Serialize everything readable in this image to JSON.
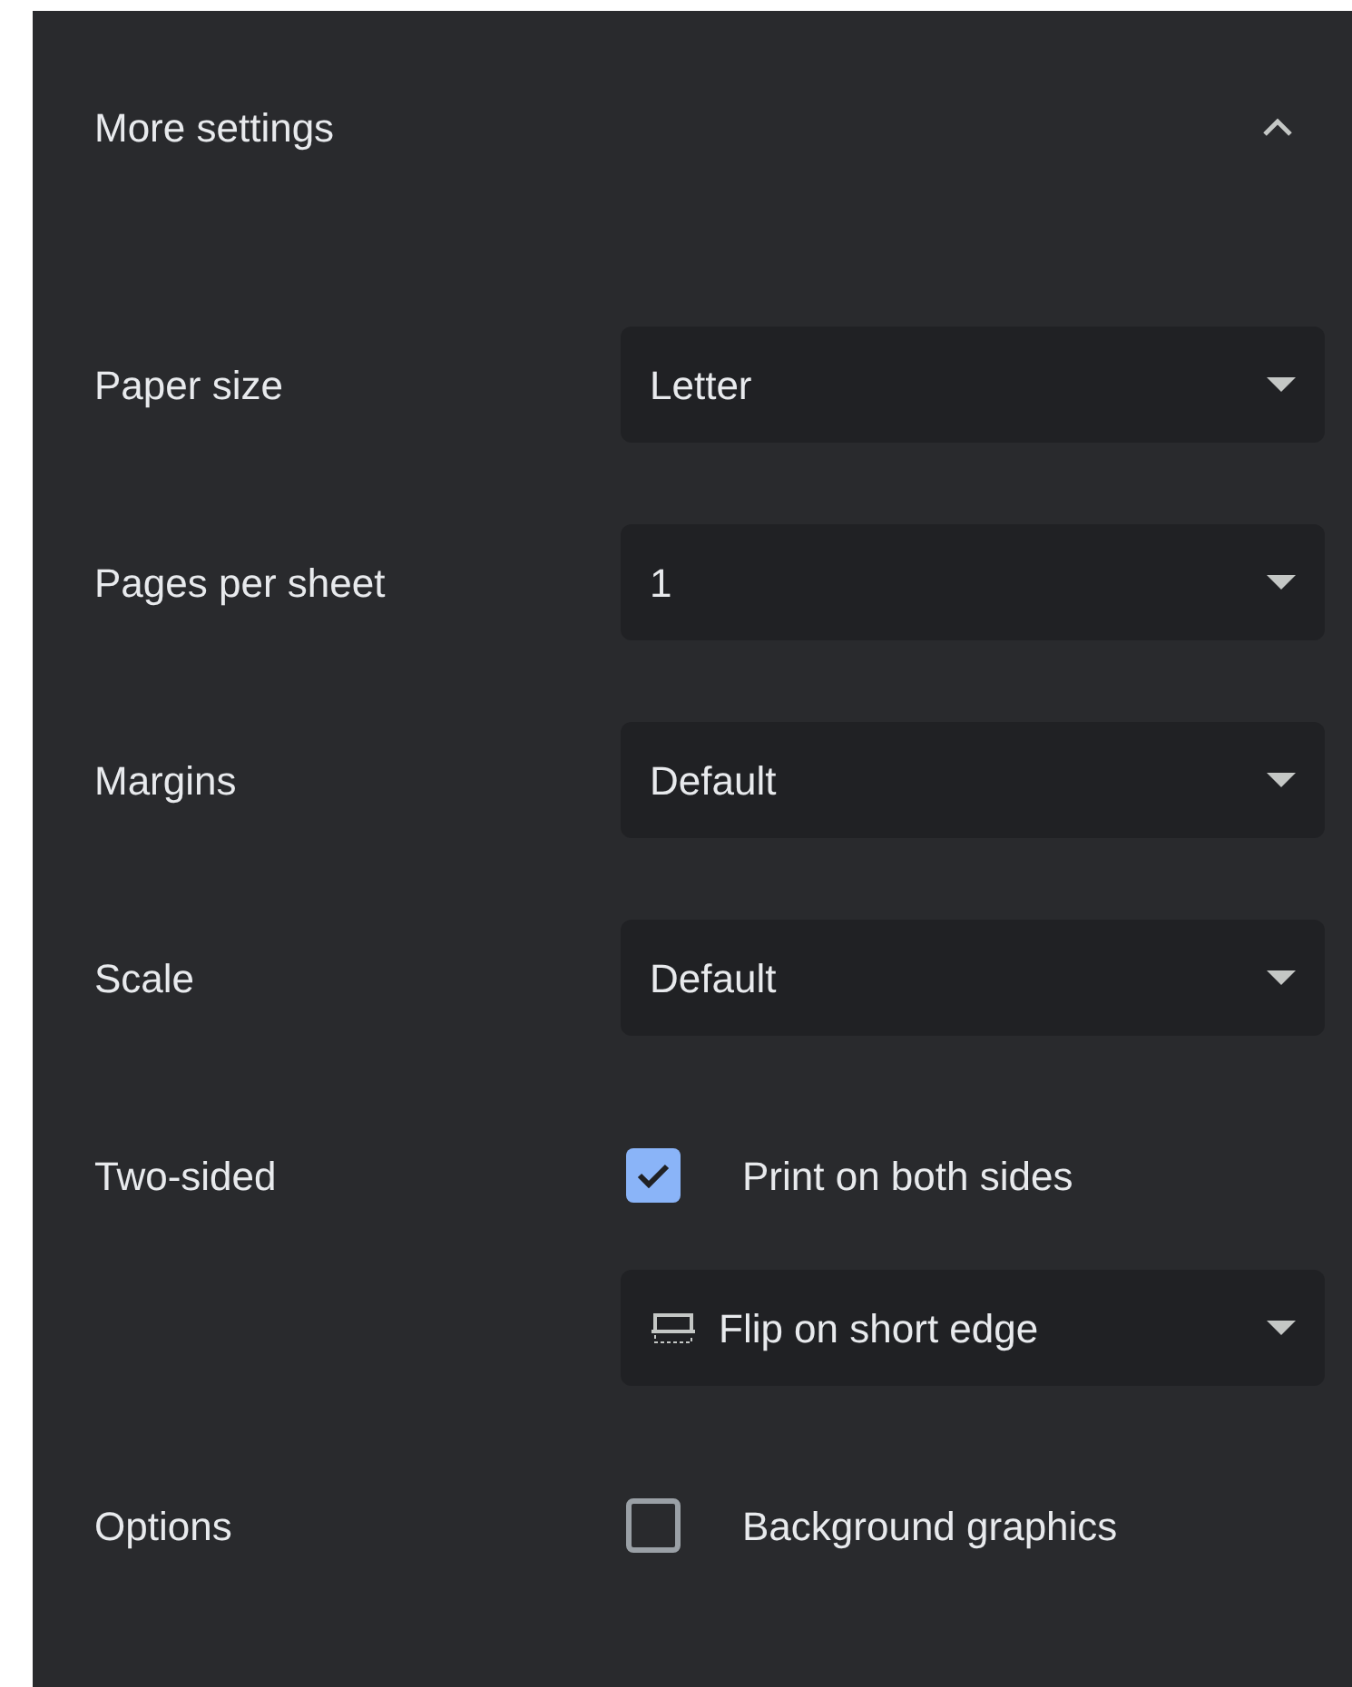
{
  "header": {
    "title": "More settings",
    "expanded": true
  },
  "rows": [
    {
      "label": "Paper size",
      "controls": [
        {
          "kind": "select",
          "value": "Letter"
        }
      ]
    },
    {
      "label": "Pages per sheet",
      "controls": [
        {
          "kind": "select",
          "value": "1"
        }
      ]
    },
    {
      "label": "Margins",
      "controls": [
        {
          "kind": "select",
          "value": "Default"
        }
      ]
    },
    {
      "label": "Scale",
      "controls": [
        {
          "kind": "select",
          "value": "Default"
        }
      ]
    },
    {
      "label": "Two-sided",
      "controls": [
        {
          "kind": "checkbox",
          "label": "Print on both sides",
          "checked": true
        },
        {
          "kind": "duplex",
          "value": "Flip on short edge"
        }
      ]
    },
    {
      "label": "Options",
      "controls": [
        {
          "kind": "checkbox",
          "label": "Background graphics",
          "checked": false
        }
      ]
    }
  ]
}
